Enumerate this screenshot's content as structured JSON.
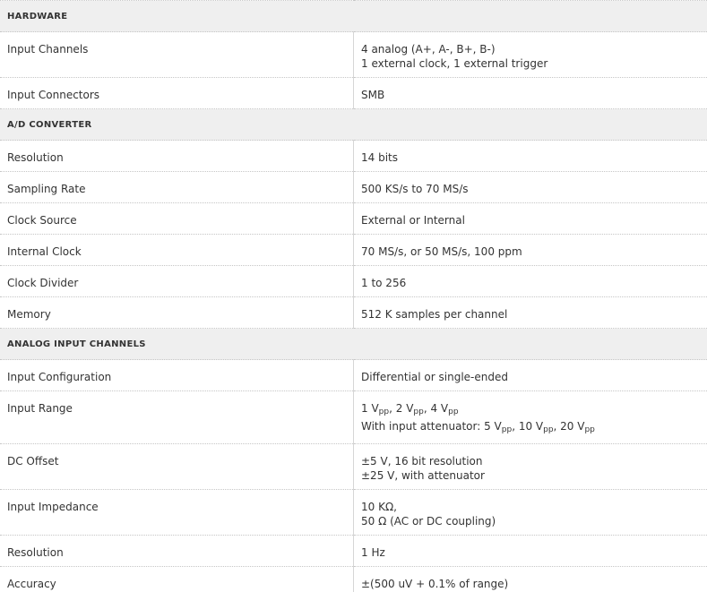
{
  "sections": {
    "hardware": "HARDWARE",
    "adc": "A/D CONVERTER",
    "analog": "ANALOG INPUT CHANNELS"
  },
  "rows": {
    "input_channels": {
      "label": "Input Channels",
      "line1": "4 analog (A+, A-, B+, B-)",
      "line2": "1 external clock, 1 external trigger"
    },
    "input_connectors": {
      "label": "Input Connectors",
      "value": "SMB"
    },
    "resolution_bits": {
      "label": "Resolution",
      "value": "14 bits"
    },
    "sampling_rate": {
      "label": "Sampling Rate",
      "value": "500 KS/s to 70 MS/s"
    },
    "clock_source": {
      "label": "Clock Source",
      "value": "External or Internal"
    },
    "internal_clock": {
      "label": "Internal Clock",
      "value": "70 MS/s, or 50 MS/s, 100 ppm"
    },
    "clock_divider": {
      "label": "Clock Divider",
      "value": "1 to 256"
    },
    "memory": {
      "label": "Memory",
      "value": "512 K samples per channel"
    },
    "input_configuration": {
      "label": "Input Configuration",
      "value": "Differential or single-ended"
    },
    "input_range": {
      "label": "Input Range",
      "line1": [
        "1 V",
        "pp",
        ", 2 V",
        "pp",
        ", 4 V",
        "pp"
      ],
      "line2": [
        "With input attenuator: 5 V",
        "pp",
        ", 10 V",
        "pp",
        ", 20 V",
        "pp"
      ]
    },
    "dc_offset": {
      "label": "DC Offset",
      "line1": "±5 V, 16 bit resolution",
      "line2": "±25 V, with attenuator"
    },
    "input_impedance": {
      "label": "Input Impedance",
      "line1": "10 KΩ,",
      "line2": "50 Ω (AC or DC coupling)"
    },
    "resolution_hz": {
      "label": "Resolution",
      "value": "1 Hz"
    },
    "accuracy": {
      "label": "Accuracy",
      "value": "±(500 uV + 0.1% of range)"
    }
  }
}
